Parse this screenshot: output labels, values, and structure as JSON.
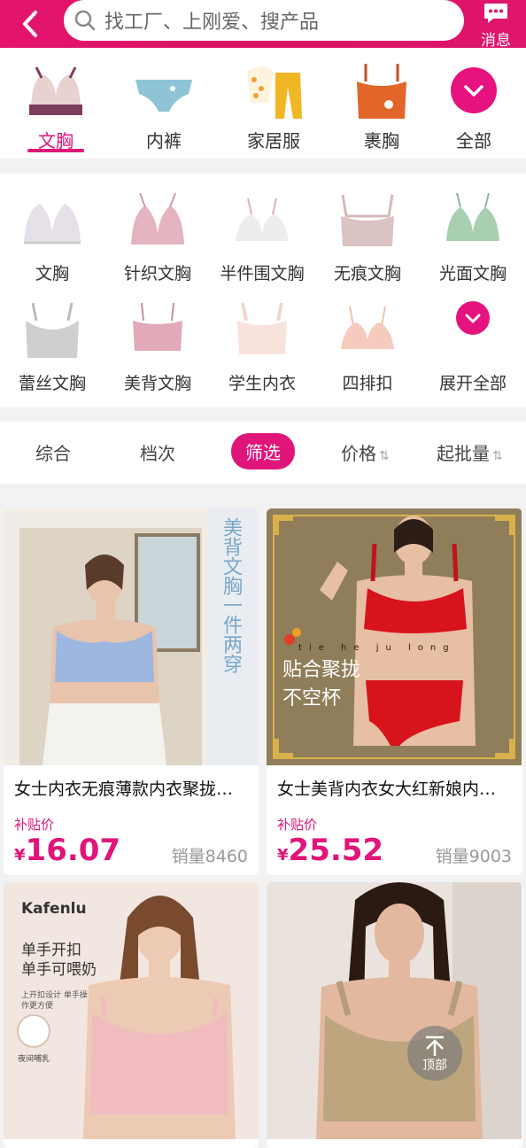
{
  "header": {
    "search_placeholder": "找工厂、上刚爱、搜产品",
    "message_label": "消息",
    "accent": "#e0157a"
  },
  "top_categories": [
    {
      "label": "文胸",
      "icon": "bra-icon",
      "active": true
    },
    {
      "label": "内裤",
      "icon": "panties-icon",
      "active": false
    },
    {
      "label": "家居服",
      "icon": "pajamas-icon",
      "active": false
    },
    {
      "label": "裹胸",
      "icon": "tube-top-icon",
      "active": false
    },
    {
      "label": "全部",
      "icon": "chevron-down-icon",
      "active": false
    }
  ],
  "sub_categories": [
    {
      "label": "文胸"
    },
    {
      "label": "针织文胸"
    },
    {
      "label": "半件围文胸"
    },
    {
      "label": "无痕文胸"
    },
    {
      "label": "光面文胸"
    },
    {
      "label": "蕾丝文胸"
    },
    {
      "label": "美背文胸"
    },
    {
      "label": "学生内衣"
    },
    {
      "label": "四排扣"
    },
    {
      "label": "展开全部"
    }
  ],
  "sort_bar": {
    "items": [
      "综合",
      "档次",
      "筛选",
      "价格",
      "起批量"
    ],
    "active": "筛选"
  },
  "products": [
    {
      "title": "女士内衣无痕薄款内衣聚拢…",
      "subsidy_label": "补贴价",
      "currency": "¥",
      "price": "16.07",
      "sales": "销量8460",
      "image_text": "美背文胸一件两穿"
    },
    {
      "title": "女士美背内衣女大红新娘内…",
      "subsidy_label": "补贴价",
      "currency": "¥",
      "price": "25.52",
      "sales": "销量9003",
      "image_text_pinyin": "tie he ju long",
      "image_text_line1": "贴合聚拢",
      "image_text_line2": "不空杯"
    },
    {
      "brand": "Kafenlu",
      "image_text_line1": "单手开扣",
      "image_text_line2": "单手可喂奶",
      "image_text_small": "上开扣设计 单手操作更方便",
      "image_badge": "夜间哺乳"
    },
    {
      "image_text": ""
    }
  ],
  "back_to_top": "顶部"
}
